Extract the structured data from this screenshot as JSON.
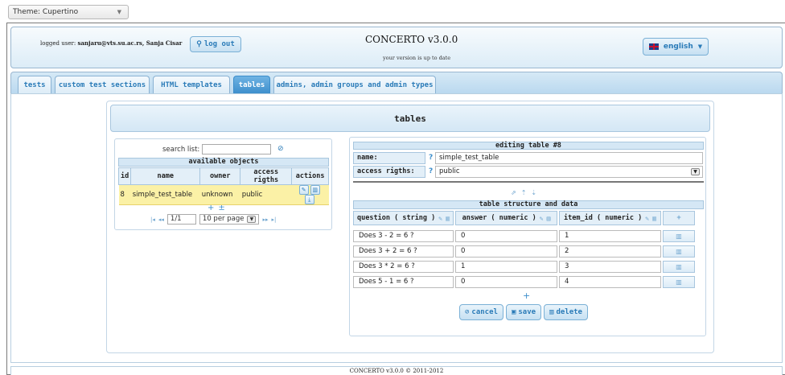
{
  "theme": {
    "label": "Theme: Cupertino"
  },
  "header": {
    "logged_prefix": "logged user:",
    "logged_user": "sanjaru@vts.su.ac.rs, Sanja Cisar",
    "logout": "log out",
    "title": "CONCERTO v3.0.0",
    "version_note": "your version is up to date",
    "language": "english"
  },
  "tabs": [
    {
      "label": "tests"
    },
    {
      "label": "custom test sections"
    },
    {
      "label": "HTML templates"
    },
    {
      "label": "tables",
      "active": true
    },
    {
      "label": "admins, admin groups and admin types"
    }
  ],
  "panel": {
    "title": "tables"
  },
  "list": {
    "search_label": "search list:",
    "search_value": "",
    "title": "available objects",
    "columns": [
      "id",
      "name",
      "owner",
      "access rigths",
      "actions"
    ],
    "rows": [
      {
        "id": "8",
        "name": "simple_test_table",
        "owner": "unknown",
        "access": "public"
      }
    ],
    "page": "1/1",
    "per_page": "10 per page"
  },
  "editor": {
    "title": "editing table #8",
    "name_label": "name:",
    "name_value": "simple_test_table",
    "access_label": "access rigths:",
    "access_value": "public",
    "help": "?",
    "structure_title": "table structure and data",
    "columns": [
      "question ( string )",
      "answer ( numeric )",
      "item_id ( numeric )"
    ],
    "rows": [
      [
        "Does 3 - 2 = 6 ?",
        "0",
        "1"
      ],
      [
        "Does 3 + 2 = 6 ?",
        "0",
        "2"
      ],
      [
        "Does 3 * 2 = 6 ?",
        "1",
        "3"
      ],
      [
        "Does 5 - 1 = 6 ?",
        "0",
        "4"
      ]
    ],
    "cancel": "cancel",
    "save": "save",
    "delete": "delete"
  },
  "footer": {
    "text": "CONCERTO v3.0.0 © 2011-2012"
  },
  "colors": {
    "accent": "#3b8dcb",
    "active_tab": "#4a9bd6",
    "row_highlight": "#fbf1a6",
    "header_bg": "#dcecf7"
  }
}
